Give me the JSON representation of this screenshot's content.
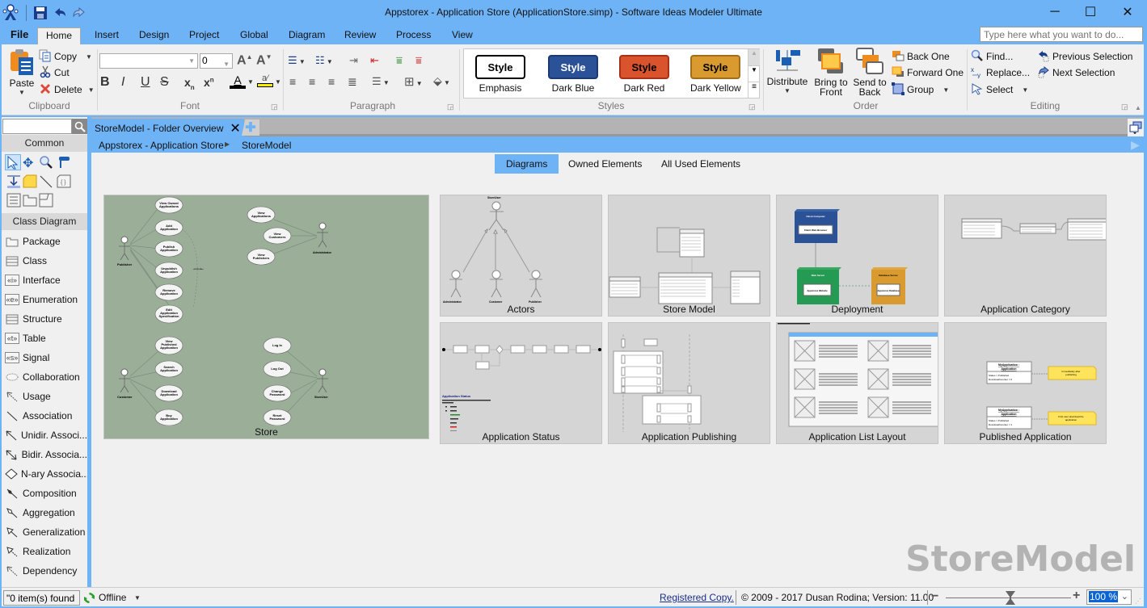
{
  "window": {
    "title": "Appstorex - Application Store (ApplicationStore.simp)  - Software Ideas Modeler Ultimate",
    "controls": [
      "minimize",
      "maximize",
      "close"
    ]
  },
  "quick_access": [
    "save-icon",
    "undo-icon",
    "redo-icon"
  ],
  "menu_tabs": [
    "File",
    "Home",
    "Insert",
    "Design",
    "Project",
    "Global",
    "Diagram",
    "Review",
    "Process",
    "View"
  ],
  "active_menu_tab": "Home",
  "search_do": {
    "placeholder": "Type here what you want to do..."
  },
  "ribbon": {
    "clipboard": {
      "label": "Clipboard",
      "paste": "Paste",
      "copy": "Copy",
      "cut": "Cut",
      "delete": "Delete"
    },
    "font": {
      "label": "Font",
      "font_name": "",
      "font_size": "0",
      "bold": "B",
      "italic": "I",
      "underline": "U",
      "strike": "S"
    },
    "paragraph": {
      "label": "Paragraph"
    },
    "styles": {
      "label": "Styles",
      "items": [
        {
          "tile": "Style",
          "name": "Emphasis",
          "bg": "#ffffff",
          "fg": "#000000",
          "border": "#000000"
        },
        {
          "tile": "Style",
          "name": "Dark Blue",
          "bg": "#2b5296",
          "fg": "#ffffff",
          "border": "#1c3a70"
        },
        {
          "tile": "Style",
          "name": "Dark Red",
          "bg": "#d9532c",
          "fg": "#000000",
          "border": "#a6301a"
        },
        {
          "tile": "Style",
          "name": "Dark Yellow",
          "bg": "#d99a30",
          "fg": "#000000",
          "border": "#a06d1a"
        }
      ]
    },
    "order": {
      "label": "Order",
      "distribute": "Distribute",
      "bring_front_1": "Bring to",
      "bring_front_2": "Front",
      "send_back_1": "Send to",
      "send_back_2": "Back",
      "back_one": "Back One",
      "forward_one": "Forward One",
      "group": "Group"
    },
    "editing": {
      "label": "Editing",
      "find": "Find...",
      "replace": "Replace...",
      "select": "Select",
      "prev_sel": "Previous Selection",
      "next_sel": "Next Selection"
    }
  },
  "left_panel": {
    "search_value": "",
    "common_header": "Common",
    "class_header": "Class Diagram",
    "tools": [
      {
        "label": "Package",
        "icon": "package-icon"
      },
      {
        "label": "Class",
        "icon": "class-icon"
      },
      {
        "label": "Interface",
        "icon": "interface-icon"
      },
      {
        "label": "Enumeration",
        "icon": "enumeration-icon"
      },
      {
        "label": "Structure",
        "icon": "structure-icon"
      },
      {
        "label": "Table",
        "icon": "table-icon"
      },
      {
        "label": "Signal",
        "icon": "signal-icon"
      },
      {
        "label": "Collaboration",
        "icon": "collaboration-icon"
      },
      {
        "label": "Usage",
        "icon": "usage-icon"
      },
      {
        "label": "Association",
        "icon": "association-icon"
      },
      {
        "label": "Unidir. Associ...",
        "icon": "unidirectional-association-icon"
      },
      {
        "label": "Bidir. Associa...",
        "icon": "bidirectional-association-icon"
      },
      {
        "label": "N-ary Associa...",
        "icon": "nary-association-icon"
      },
      {
        "label": "Composition",
        "icon": "composition-icon"
      },
      {
        "label": "Aggregation",
        "icon": "aggregation-icon"
      },
      {
        "label": "Generalization",
        "icon": "generalization-icon"
      },
      {
        "label": "Realization",
        "icon": "realization-icon"
      },
      {
        "label": "Dependency",
        "icon": "dependency-icon"
      }
    ]
  },
  "document": {
    "tab_title": "StoreModel - Folder Overview",
    "breadcrumb": [
      "Appstorex - Application Store",
      "StoreModel"
    ],
    "view_tabs": [
      "Diagrams",
      "Owned Elements",
      "All Used Elements"
    ],
    "active_view_tab": "Diagrams",
    "diagrams": [
      {
        "name": "Store",
        "kind": "use-case"
      },
      {
        "name": "Actors",
        "kind": "actors"
      },
      {
        "name": "Store Model",
        "kind": "class"
      },
      {
        "name": "Deployment",
        "kind": "deployment"
      },
      {
        "name": "Application Category",
        "kind": "class"
      },
      {
        "name": "Application Status",
        "kind": "state"
      },
      {
        "name": "Application Publishing",
        "kind": "sequence"
      },
      {
        "name": "Application List Layout",
        "kind": "wireframe"
      },
      {
        "name": "Published Application",
        "kind": "object"
      }
    ],
    "store_diagram": {
      "actors": [
        "Publisher",
        "Administrator",
        "Customer",
        "StoreUser"
      ],
      "publisher_cases": [
        "View Owned Applications",
        "Add Application",
        "Publish Application",
        "Unpublish Application",
        "Remove Application",
        "Edit Application Specification"
      ],
      "admin_cases": [
        "View Applications",
        "View Customers",
        "View Publishers"
      ],
      "customer_cases": [
        "View Published Application",
        "Search Application",
        "Download Application",
        "Buy Application"
      ],
      "user_cases": [
        "Log In",
        "Log Out",
        "Change Password",
        "Reset Password"
      ],
      "include_label": "«include»"
    },
    "actors_diagram": {
      "parent": "StoreUser",
      "children": [
        "Administrator",
        "Customer",
        "Publisher"
      ]
    },
    "published_notes": [
      "Immediately after publishing",
      "First user download the application"
    ],
    "watermark": "StoreModel"
  },
  "status_bar": {
    "found": "\"0 item(s) found",
    "online_status": "Offline",
    "registered": "Registered Copy.",
    "copyright": "© 2009 - 2017 Dusan Rodina; Version: 11.00",
    "zoom": "100 %",
    "zoom_fraction": 0.5
  }
}
